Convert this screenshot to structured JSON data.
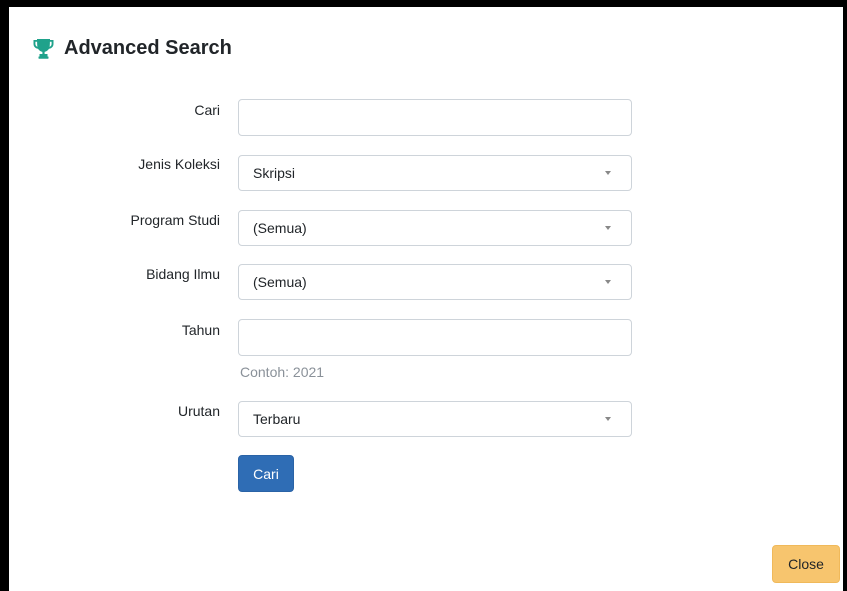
{
  "modal": {
    "title": "Advanced Search",
    "title_icon": "trophy-icon",
    "accent_color": "#1fa28b"
  },
  "form": {
    "cari": {
      "label": "Cari",
      "value": "",
      "placeholder": ""
    },
    "jenis_koleksi": {
      "label": "Jenis Koleksi",
      "selected": "Skripsi"
    },
    "program_studi": {
      "label": "Program Studi",
      "selected": "(Semua)"
    },
    "bidang_ilmu": {
      "label": "Bidang Ilmu",
      "selected": "(Semua)"
    },
    "tahun": {
      "label": "Tahun",
      "value": "",
      "placeholder": "",
      "help": "Contoh: 2021"
    },
    "urutan": {
      "label": "Urutan",
      "selected": "Terbaru"
    },
    "submit_label": "Cari"
  },
  "footer": {
    "close_label": "Close"
  },
  "colors": {
    "primary": "#2f6db5",
    "warning": "#f7c56e"
  }
}
